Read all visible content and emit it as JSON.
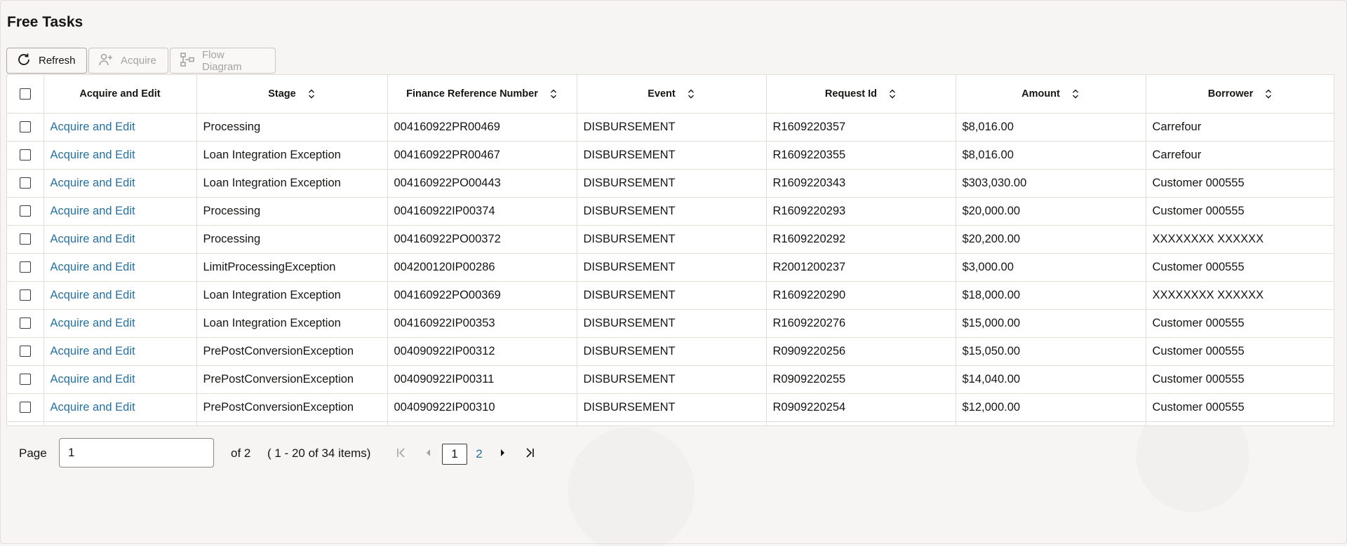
{
  "page_title": "Free Tasks",
  "toolbar": {
    "refresh_label": "Refresh",
    "acquire_label": "Acquire",
    "flow_label": "Flow Diagram"
  },
  "columns": [
    "Acquire and Edit",
    "Stage",
    "Finance Reference Number",
    "Event",
    "Request Id",
    "Amount",
    "Borrower"
  ],
  "rows": [
    {
      "action": "Acquire and Edit",
      "stage": "Processing",
      "ref": "004160922PR00469",
      "event": "DISBURSEMENT",
      "request_id": "R1609220357",
      "amount": "$8,016.00",
      "borrower": "Carrefour"
    },
    {
      "action": "Acquire and Edit",
      "stage": "Loan Integration Exception",
      "ref": "004160922PR00467",
      "event": "DISBURSEMENT",
      "request_id": "R1609220355",
      "amount": "$8,016.00",
      "borrower": "Carrefour"
    },
    {
      "action": "Acquire and Edit",
      "stage": "Loan Integration Exception",
      "ref": "004160922PO00443",
      "event": "DISBURSEMENT",
      "request_id": "R1609220343",
      "amount": "$303,030.00",
      "borrower": "Customer 000555"
    },
    {
      "action": "Acquire and Edit",
      "stage": "Processing",
      "ref": "004160922IP00374",
      "event": "DISBURSEMENT",
      "request_id": "R1609220293",
      "amount": "$20,000.00",
      "borrower": "Customer 000555"
    },
    {
      "action": "Acquire and Edit",
      "stage": "Processing",
      "ref": "004160922PO00372",
      "event": "DISBURSEMENT",
      "request_id": "R1609220292",
      "amount": "$20,200.00",
      "borrower": "XXXXXXXX XXXXXX"
    },
    {
      "action": "Acquire and Edit",
      "stage": "LimitProcessingException",
      "ref": "004200120IP00286",
      "event": "DISBURSEMENT",
      "request_id": "R2001200237",
      "amount": "$3,000.00",
      "borrower": "Customer 000555"
    },
    {
      "action": "Acquire and Edit",
      "stage": "Loan Integration Exception",
      "ref": "004160922PO00369",
      "event": "DISBURSEMENT",
      "request_id": "R1609220290",
      "amount": "$18,000.00",
      "borrower": "XXXXXXXX XXXXXX"
    },
    {
      "action": "Acquire and Edit",
      "stage": "Loan Integration Exception",
      "ref": "004160922IP00353",
      "event": "DISBURSEMENT",
      "request_id": "R1609220276",
      "amount": "$15,000.00",
      "borrower": "Customer 000555"
    },
    {
      "action": "Acquire and Edit",
      "stage": "PrePostConversionException",
      "ref": "004090922IP00312",
      "event": "DISBURSEMENT",
      "request_id": "R0909220256",
      "amount": "$15,050.00",
      "borrower": "Customer 000555"
    },
    {
      "action": "Acquire and Edit",
      "stage": "PrePostConversionException",
      "ref": "004090922IP00311",
      "event": "DISBURSEMENT",
      "request_id": "R0909220255",
      "amount": "$14,040.00",
      "borrower": "Customer 000555"
    },
    {
      "action": "Acquire and Edit",
      "stage": "PrePostConversionException",
      "ref": "004090922IP00310",
      "event": "DISBURSEMENT",
      "request_id": "R0909220254",
      "amount": "$12,000.00",
      "borrower": "Customer 000555"
    }
  ],
  "pager": {
    "label": "Page",
    "current_value": "1",
    "of_text": "of 2",
    "range_text": "( 1 - 20 of 34 items)",
    "current_page": "1",
    "other_page": "2"
  },
  "colors": {
    "link": "#2a6f97",
    "border": "#e1ded9",
    "text": "#161513"
  },
  "icons": [
    "refresh-icon",
    "acquire-user-icon",
    "flow-diagram-icon",
    "sort-icon",
    "first-page-icon",
    "prev-page-icon",
    "next-page-icon",
    "last-page-icon"
  ]
}
